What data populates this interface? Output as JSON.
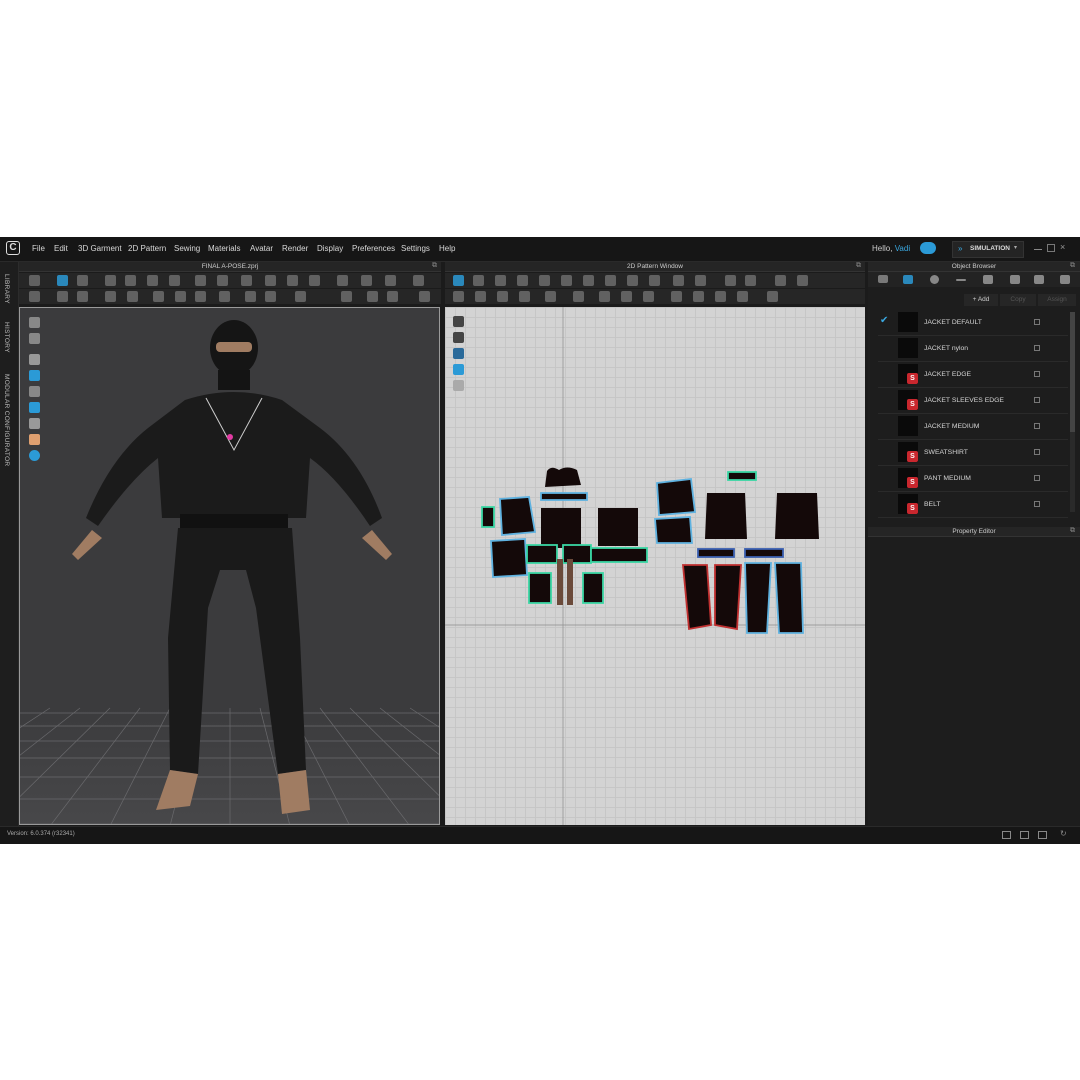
{
  "app": {
    "logo": "C",
    "version": "Version: 6.0.374 (r32341)"
  },
  "menu": [
    "File",
    "Edit",
    "3D Garment",
    "2D Pattern",
    "Sewing",
    "Materials",
    "Avatar",
    "Render",
    "Display",
    "Preferences",
    "Settings",
    "Help"
  ],
  "user": {
    "greeting": "Hello,",
    "name": "Vadi"
  },
  "mode": {
    "label": "SIMULATION"
  },
  "sidebar": {
    "tabs": [
      "LIBRARY",
      "HISTORY",
      "MODULAR CONFIGURATOR"
    ]
  },
  "panels": {
    "view3d_title": "FINAL A-POSE.zprj",
    "view2d_title": "2D Pattern Window",
    "object_browser_title": "Object Browser",
    "property_editor_title": "Property Editor"
  },
  "object_browser": {
    "add_label": "+ Add",
    "copy_label": "Copy",
    "assign_label": "Assign",
    "items": [
      {
        "name": "JACKET DEFAULT",
        "checked": true,
        "icon": false
      },
      {
        "name": "JACKET nylon",
        "checked": false,
        "icon": false
      },
      {
        "name": "JACKET EDGE",
        "checked": false,
        "icon": true
      },
      {
        "name": "JACKET SLEEVES EDGE",
        "checked": false,
        "icon": true
      },
      {
        "name": "JACKET MEDIUM",
        "checked": false,
        "icon": false
      },
      {
        "name": "SWEATSHIRT",
        "checked": false,
        "icon": true
      },
      {
        "name": "PANT MEDIUM",
        "checked": false,
        "icon": true
      },
      {
        "name": "BELT",
        "checked": false,
        "icon": true
      }
    ]
  },
  "colors": {
    "accent": "#2b9ad6",
    "fabric_icon": "#c9272e",
    "viewport_3d": "#3b3b3d",
    "viewport_2d": "#d3d3d3"
  }
}
